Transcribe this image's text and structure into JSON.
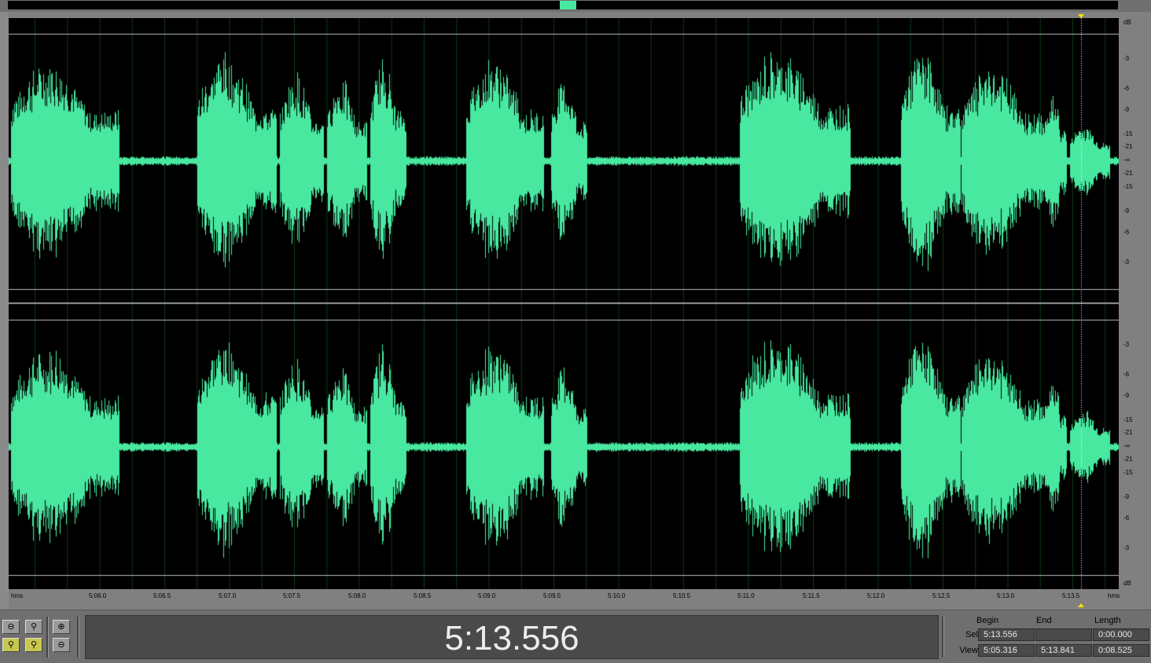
{
  "colors": {
    "waveform": "#48e8a0",
    "background": "#000000",
    "grid": "#0f3a12",
    "cursor_marker": "#ffe000"
  },
  "db_scale": {
    "unit": "dB",
    "labels": [
      "-3",
      "-6",
      "-9",
      "-15",
      "-21",
      "-∞",
      "-21",
      "-15",
      "-9",
      "-6",
      "-3"
    ]
  },
  "time_scale": {
    "unit": "hms",
    "ticks": [
      "5:06.0",
      "5:06.5",
      "5:07.0",
      "5:07.5",
      "5:08.0",
      "5:08.5",
      "5:09.0",
      "5:09.5",
      "5:10.0",
      "5:10.5",
      "5:11.0",
      "5:11.5",
      "5:12.0",
      "5:12.5",
      "5:13.0",
      "5:13.5"
    ]
  },
  "zoom_buttons": [
    "zoom-out-icon",
    "zoom-selection-icon",
    "zoom-in-vertical-icon",
    "zoom-left-icon",
    "zoom-right-icon",
    "zoom-out-vertical-icon"
  ],
  "time_display": "5:13.556",
  "selection_info": {
    "headers": {
      "begin": "Begin",
      "end": "End",
      "length": "Length"
    },
    "sel": {
      "label": "Sel",
      "begin": "5:13.556",
      "end": "",
      "length": "0:00.000"
    },
    "view": {
      "label": "View",
      "begin": "5:05.316",
      "end": "5:13.841",
      "length": "0:08.525"
    }
  }
}
